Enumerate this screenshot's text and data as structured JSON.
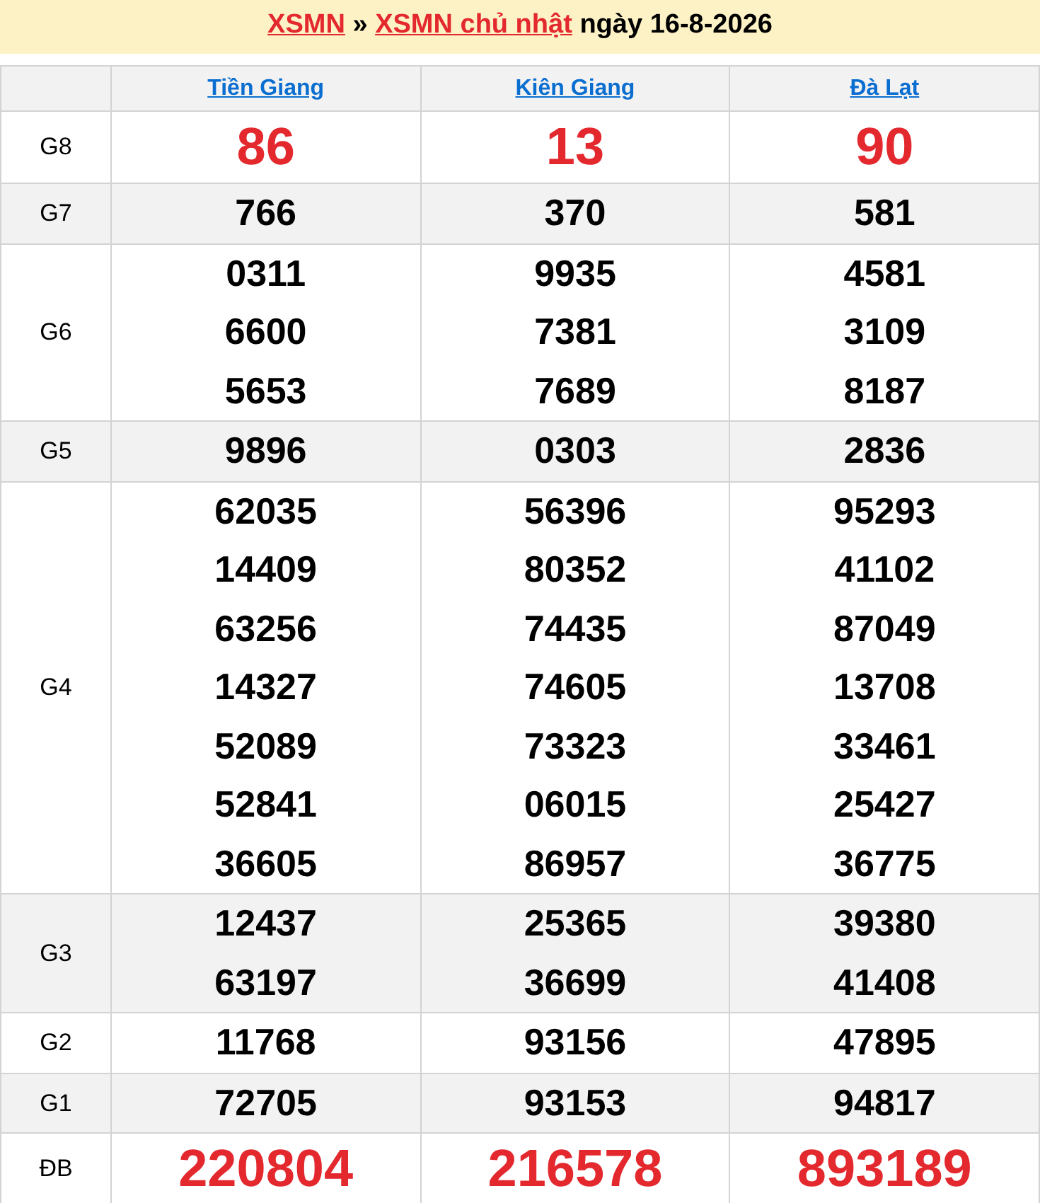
{
  "title": {
    "home_link": "XSMN",
    "separator": "»",
    "day_link": "XSMN chủ nhật",
    "date_text": "ngày 16-8-2026"
  },
  "provinces": [
    "Tiền Giang",
    "Kiên Giang",
    "Đà Lạt"
  ],
  "prizes": [
    {
      "label": "G8",
      "kind": "special",
      "results": [
        [
          "86"
        ],
        [
          "13"
        ],
        [
          "90"
        ]
      ]
    },
    {
      "label": "G7",
      "kind": "normal",
      "results": [
        [
          "766"
        ],
        [
          "370"
        ],
        [
          "581"
        ]
      ]
    },
    {
      "label": "G6",
      "kind": "normal",
      "results": [
        [
          "0311",
          "6600",
          "5653"
        ],
        [
          "9935",
          "7381",
          "7689"
        ],
        [
          "4581",
          "3109",
          "8187"
        ]
      ]
    },
    {
      "label": "G5",
      "kind": "normal",
      "results": [
        [
          "9896"
        ],
        [
          "0303"
        ],
        [
          "2836"
        ]
      ]
    },
    {
      "label": "G4",
      "kind": "normal",
      "results": [
        [
          "62035",
          "14409",
          "63256",
          "14327",
          "52089",
          "52841",
          "36605"
        ],
        [
          "56396",
          "80352",
          "74435",
          "74605",
          "73323",
          "06015",
          "86957"
        ],
        [
          "95293",
          "41102",
          "87049",
          "13708",
          "33461",
          "25427",
          "36775"
        ]
      ]
    },
    {
      "label": "G3",
      "kind": "normal",
      "results": [
        [
          "12437",
          "63197"
        ],
        [
          "25365",
          "36699"
        ],
        [
          "39380",
          "41408"
        ]
      ]
    },
    {
      "label": "G2",
      "kind": "normal",
      "results": [
        [
          "11768"
        ],
        [
          "93156"
        ],
        [
          "47895"
        ]
      ]
    },
    {
      "label": "G1",
      "kind": "normal",
      "results": [
        [
          "72705"
        ],
        [
          "93153"
        ],
        [
          "94817"
        ]
      ]
    },
    {
      "label": "ĐB",
      "kind": "special",
      "results": [
        [
          "220804"
        ],
        [
          "216578"
        ],
        [
          "893189"
        ]
      ]
    }
  ]
}
